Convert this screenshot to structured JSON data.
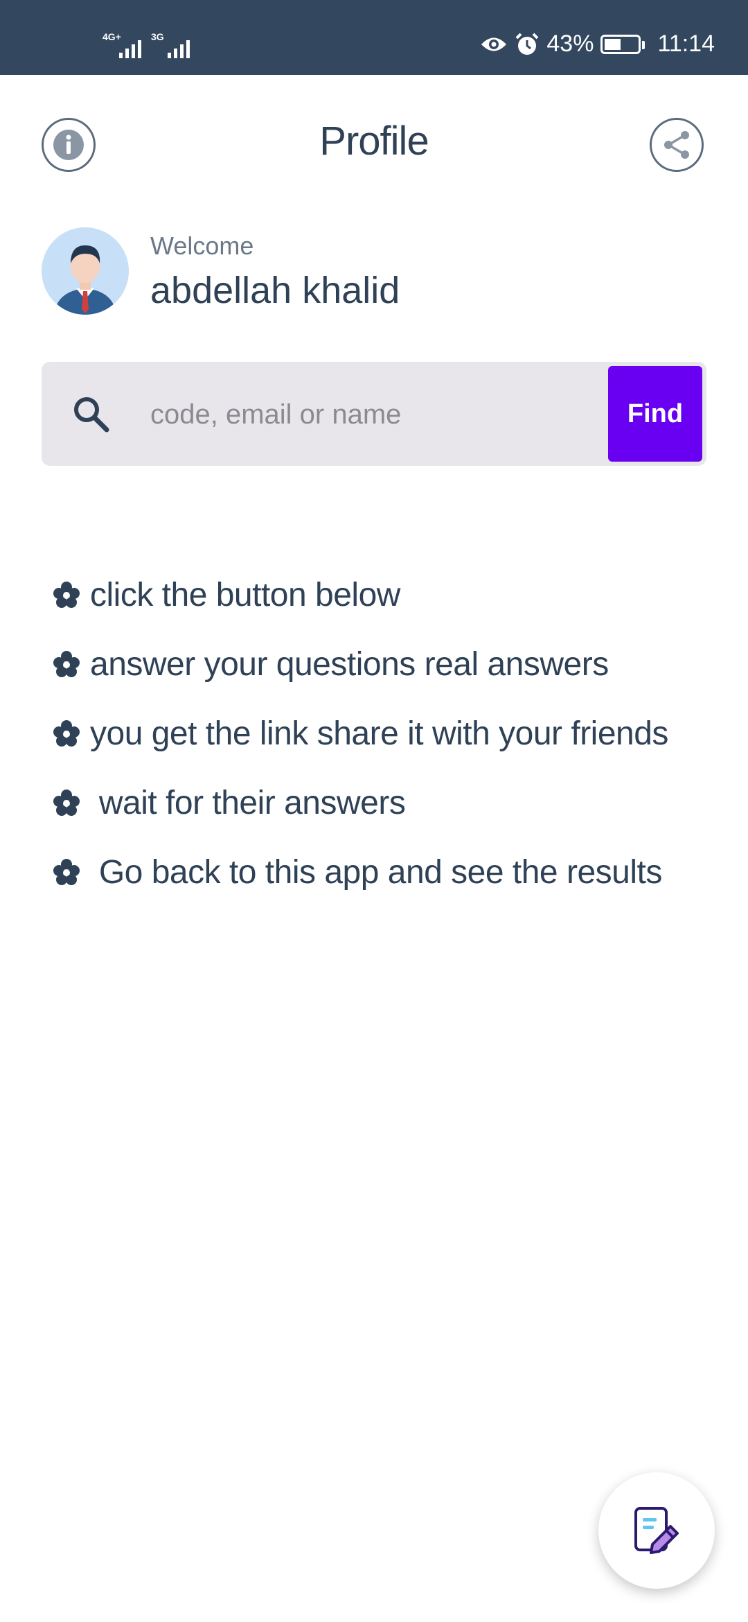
{
  "status_bar": {
    "network_1": "4G+",
    "network_2": "3G",
    "battery_percent": "43%",
    "time": "11:14"
  },
  "header": {
    "title": "Profile"
  },
  "profile": {
    "welcome_label": "Welcome",
    "user_name": "abdellah khalid"
  },
  "search": {
    "placeholder": "code, email or name",
    "value": "",
    "find_label": "Find"
  },
  "instructions": [
    "click the button below",
    "answer your questions  real answers",
    "you get the link share it with your friends",
    " wait for their answers",
    " Go back to this app and see the results"
  ],
  "icons": {
    "info": "info-icon",
    "share": "share-icon",
    "search": "search-icon",
    "bullet": "flower-icon",
    "fab": "edit-document-icon"
  },
  "colors": {
    "status_bar": "#33475e",
    "primary_text": "#2f4156",
    "find_button": "#6a00f2",
    "search_bg": "#e8e6ea"
  }
}
